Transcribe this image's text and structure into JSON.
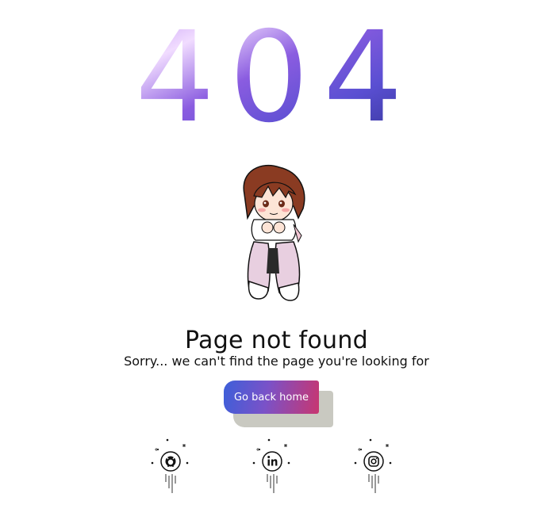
{
  "error": {
    "code": "404"
  },
  "heading": "Page not found",
  "message": "Sorry... we can't find the page you're looking for",
  "actions": {
    "home_label": "Go back home"
  },
  "social": [
    {
      "name": "github",
      "icon": "github-icon"
    },
    {
      "name": "linkedin",
      "icon": "linkedin-icon"
    },
    {
      "name": "instagram",
      "icon": "instagram-icon"
    }
  ],
  "colors": {
    "galaxy_light": "#efd6ff",
    "galaxy_mid": "#8a5ce0",
    "galaxy_dark": "#2c2f8a",
    "button_start": "#3d5fd9",
    "button_end": "#c83670",
    "button_shadow": "#c9c9c1"
  }
}
